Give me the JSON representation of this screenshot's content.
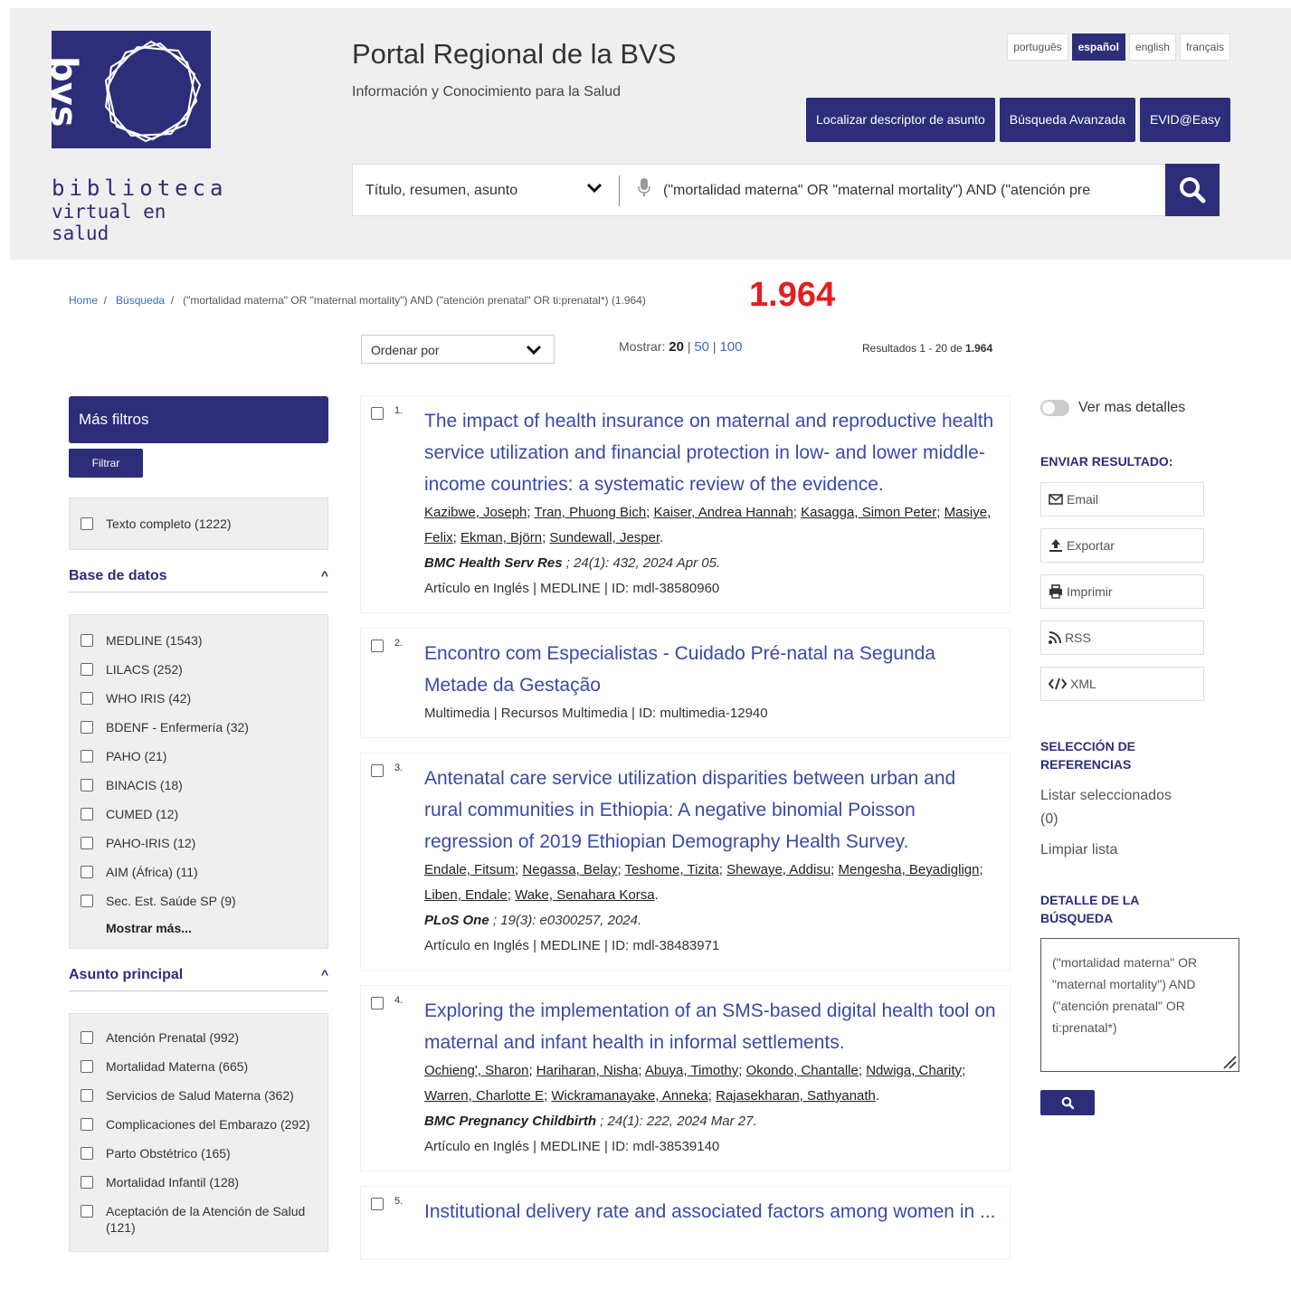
{
  "header": {
    "logo_word1": "biblioteca",
    "logo_word2": "virtual en salud",
    "title": "Portal Regional de la BVS",
    "subtitle": "Información y Conocimiento para la Salud",
    "languages": [
      "português",
      "español",
      "english",
      "français"
    ],
    "active_language": "español",
    "buttons": [
      "Localizar descriptor de asunto",
      "Búsqueda Avanzada",
      "EVID@Easy"
    ]
  },
  "search": {
    "field": "Título, resumen, asunto",
    "query": "(\"mortalidad materna\" OR \"maternal mortality\") AND (\"atención pre"
  },
  "breadcrumb": {
    "home": "Home",
    "busqueda": "Búsqueda",
    "current": "(\"mortalidad materna\" OR \"maternal mortality\") AND (\"atención prenatal\" OR ti:prenatal*) (1.964)"
  },
  "big_count": "1.964",
  "toolbar": {
    "sort_label": "Ordenar por",
    "mostrar_label": "Mostrar:",
    "mostrar_current": "20",
    "mostrar_50": "50",
    "mostrar_100": "100",
    "resultados_prefix": "Resultados 1 - 20 de",
    "resultados_total": "1.964"
  },
  "left": {
    "mas_filtros": "Más filtros",
    "filtrar": "Filtrar",
    "texto_completo": "Texto completo (1222)",
    "base_datos_title": "Base de datos",
    "base_datos": [
      "MEDLINE (1543)",
      "LILACS (252)",
      "WHO IRIS (42)",
      "BDENF - Enfermería (32)",
      "PAHO (21)",
      "BINACIS (18)",
      "CUMED (12)",
      "PAHO-IRIS (12)",
      "AIM (África) (11)",
      "Sec. Est. Saúde SP (9)"
    ],
    "mostrar_mas": "Mostrar más...",
    "asunto_title": "Asunto principal",
    "asunto": [
      "Atención Prenatal (992)",
      "Mortalidad Materna (665)",
      "Servicios de Salud Materna (362)",
      "Complicaciones del Embarazo (292)",
      "Parto Obstétrico (165)",
      "Mortalidad Infantil (128)",
      "Aceptación de la Atención de Salud (121)"
    ]
  },
  "results": [
    {
      "num": "1.",
      "title": "The impact of health insurance on maternal and reproductive health service utilization and financial protection in low- and lower middle-income countries: a systematic review of the evidence.",
      "authors": [
        "Kazibwe, Joseph",
        "Tran, Phuong Bich",
        "Kaiser, Andrea Hannah",
        "Kasagga, Simon Peter",
        "Masiye, Felix",
        "Ekman, Björn",
        "Sundewall, Jesper"
      ],
      "journal": "BMC Health Serv Res",
      "citation": " ; 24(1): 432, 2024 Apr 05.",
      "meta": "Artículo en Inglés | MEDLINE | ID: mdl-38580960"
    },
    {
      "num": "2.",
      "title": "Encontro com Especialistas - Cuidado Pré-natal na Segunda Metade da Gestação",
      "authors": [],
      "journal": "",
      "citation": "",
      "meta": "Multimedia | Recursos Multimedia | ID: multimedia-12940"
    },
    {
      "num": "3.",
      "title": "Antenatal care service utilization disparities between urban and rural communities in Ethiopia: A negative binomial Poisson regression of 2019 Ethiopian Demography Health Survey.",
      "authors": [
        "Endale, Fitsum",
        "Negassa, Belay",
        "Teshome, Tizita",
        "Shewaye, Addisu",
        "Mengesha, Beyadiglign",
        "Liben, Endale",
        "Wake, Senahara Korsa"
      ],
      "journal": "PLoS One",
      "citation": " ; 19(3): e0300257, 2024.",
      "meta": "Artículo en Inglés | MEDLINE | ID: mdl-38483971"
    },
    {
      "num": "4.",
      "title": "Exploring the implementation of an SMS-based digital health tool on maternal and infant health in informal settlements.",
      "authors": [
        "Ochieng', Sharon",
        "Hariharan, Nisha",
        "Abuya, Timothy",
        "Okondo, Chantalle",
        "Ndwiga, Charity",
        "Warren, Charlotte E",
        "Wickramanayake, Anneka",
        "Rajasekharan, Sathyanath"
      ],
      "journal": "BMC Pregnancy Childbirth",
      "citation": " ; 24(1): 222, 2024 Mar 27.",
      "meta": "Artículo en Inglés | MEDLINE | ID: mdl-38539140"
    },
    {
      "num": "5.",
      "title": "Institutional delivery rate and associated factors among women in ...",
      "authors": [],
      "journal": "",
      "citation": "",
      "meta": ""
    }
  ],
  "right": {
    "ver_mas": "Ver mas detalles",
    "enviar": "ENVIAR RESULTADO:",
    "email": "Email",
    "exportar": "Exportar",
    "imprimir": "Imprimir",
    "rss": "RSS",
    "xml": "XML",
    "seleccion": "SELECCIÓN DE REFERENCIAS",
    "listar": "Listar seleccionados",
    "listar_count": "(0)",
    "limpiar": "Limpiar lista",
    "detalle": "DETALLE DE LA BÚSQUEDA",
    "detalle_text": "(\"mortalidad materna\" OR \"maternal mortality\") AND (\"atención prenatal\" OR ti:prenatal*)"
  },
  "colors": {
    "brand": "#2d2d7a",
    "link": "#3a4aa8",
    "highlight": "#e41e1e"
  }
}
